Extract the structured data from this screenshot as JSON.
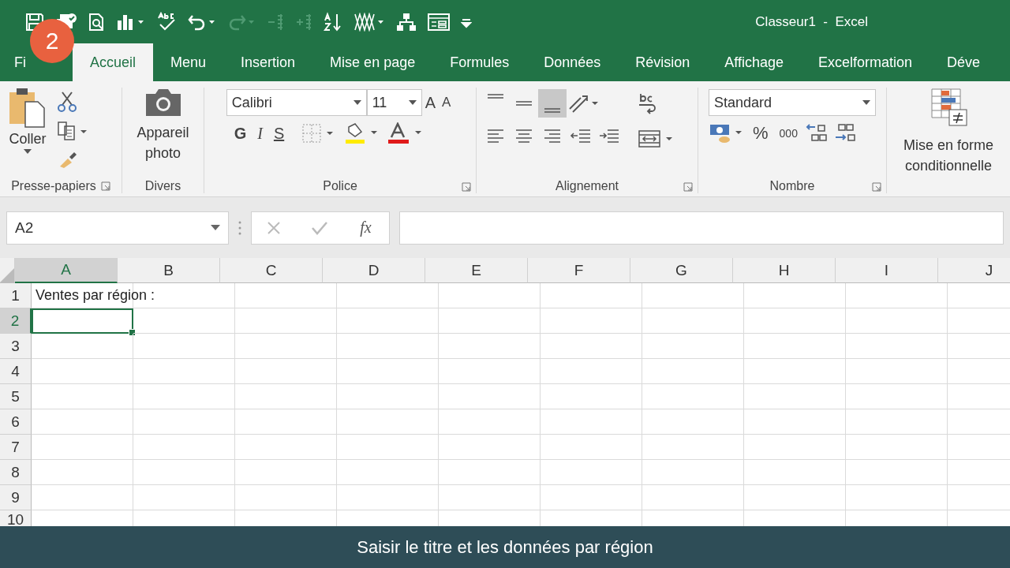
{
  "window": {
    "title": "Classeur1  -  Excel"
  },
  "step_badge": "2",
  "tabs": [
    {
      "label": "Fi",
      "selected": false
    },
    {
      "label": "Accueil",
      "selected": true
    },
    {
      "label": "Menu",
      "selected": false
    },
    {
      "label": "Insertion",
      "selected": false
    },
    {
      "label": "Mise en page",
      "selected": false
    },
    {
      "label": "Formules",
      "selected": false
    },
    {
      "label": "Données",
      "selected": false
    },
    {
      "label": "Révision",
      "selected": false
    },
    {
      "label": "Affichage",
      "selected": false
    },
    {
      "label": "Excelformation",
      "selected": false
    },
    {
      "label": "Déve",
      "selected": false
    }
  ],
  "ribbon": {
    "clipboard": {
      "paste": "Coller",
      "group": "Presse-papiers"
    },
    "divers": {
      "camera": "Appareil photo",
      "group": "Divers"
    },
    "font": {
      "name": "Calibri",
      "size": "11",
      "grow": "A",
      "shrink": "A",
      "bold": "G",
      "italic": "I",
      "underline": "S",
      "group": "Police"
    },
    "alignment": {
      "buttons": [
        {
          "kind": "top",
          "selected": false
        },
        {
          "kind": "middle",
          "selected": false
        },
        {
          "kind": "bottom",
          "selected": true
        },
        {
          "kind": "left",
          "selected": false
        },
        {
          "kind": "center",
          "selected": false
        },
        {
          "kind": "right",
          "selected": false
        },
        {
          "kind": "outdent",
          "selected": false
        },
        {
          "kind": "indent",
          "selected": false
        }
      ],
      "group": "Alignement"
    },
    "number": {
      "format": "Standard",
      "percent": "%",
      "thousands": "000",
      "group": "Nombre"
    },
    "styles": {
      "conditional": "Mise en forme conditionnelle"
    }
  },
  "formula_bar": {
    "name_box": "A2",
    "fx": "fx"
  },
  "sheet": {
    "columns": [
      {
        "label": "A",
        "selected": true
      },
      {
        "label": "B",
        "selected": false
      },
      {
        "label": "C",
        "selected": false
      },
      {
        "label": "D",
        "selected": false
      },
      {
        "label": "E",
        "selected": false
      },
      {
        "label": "F",
        "selected": false
      },
      {
        "label": "G",
        "selected": false
      },
      {
        "label": "H",
        "selected": false
      },
      {
        "label": "I",
        "selected": false
      },
      {
        "label": "J",
        "selected": false
      }
    ],
    "rows": [
      {
        "label": "1",
        "selected": false,
        "cells": [
          {
            "text": "Ventes par région :",
            "selected": false
          }
        ]
      },
      {
        "label": "2",
        "selected": true,
        "cells": [
          {
            "selected": true
          }
        ]
      },
      {
        "label": "3",
        "selected": false,
        "cells": []
      },
      {
        "label": "4",
        "selected": false,
        "cells": []
      },
      {
        "label": "5",
        "selected": false,
        "cells": []
      },
      {
        "label": "6",
        "selected": false,
        "cells": []
      },
      {
        "label": "7",
        "selected": false,
        "cells": []
      },
      {
        "label": "8",
        "selected": false,
        "cells": []
      },
      {
        "label": "9",
        "selected": false,
        "cells": []
      },
      {
        "label": "10",
        "selected": false,
        "cells": []
      }
    ]
  },
  "caption": "Saisir le titre et les données par région"
}
